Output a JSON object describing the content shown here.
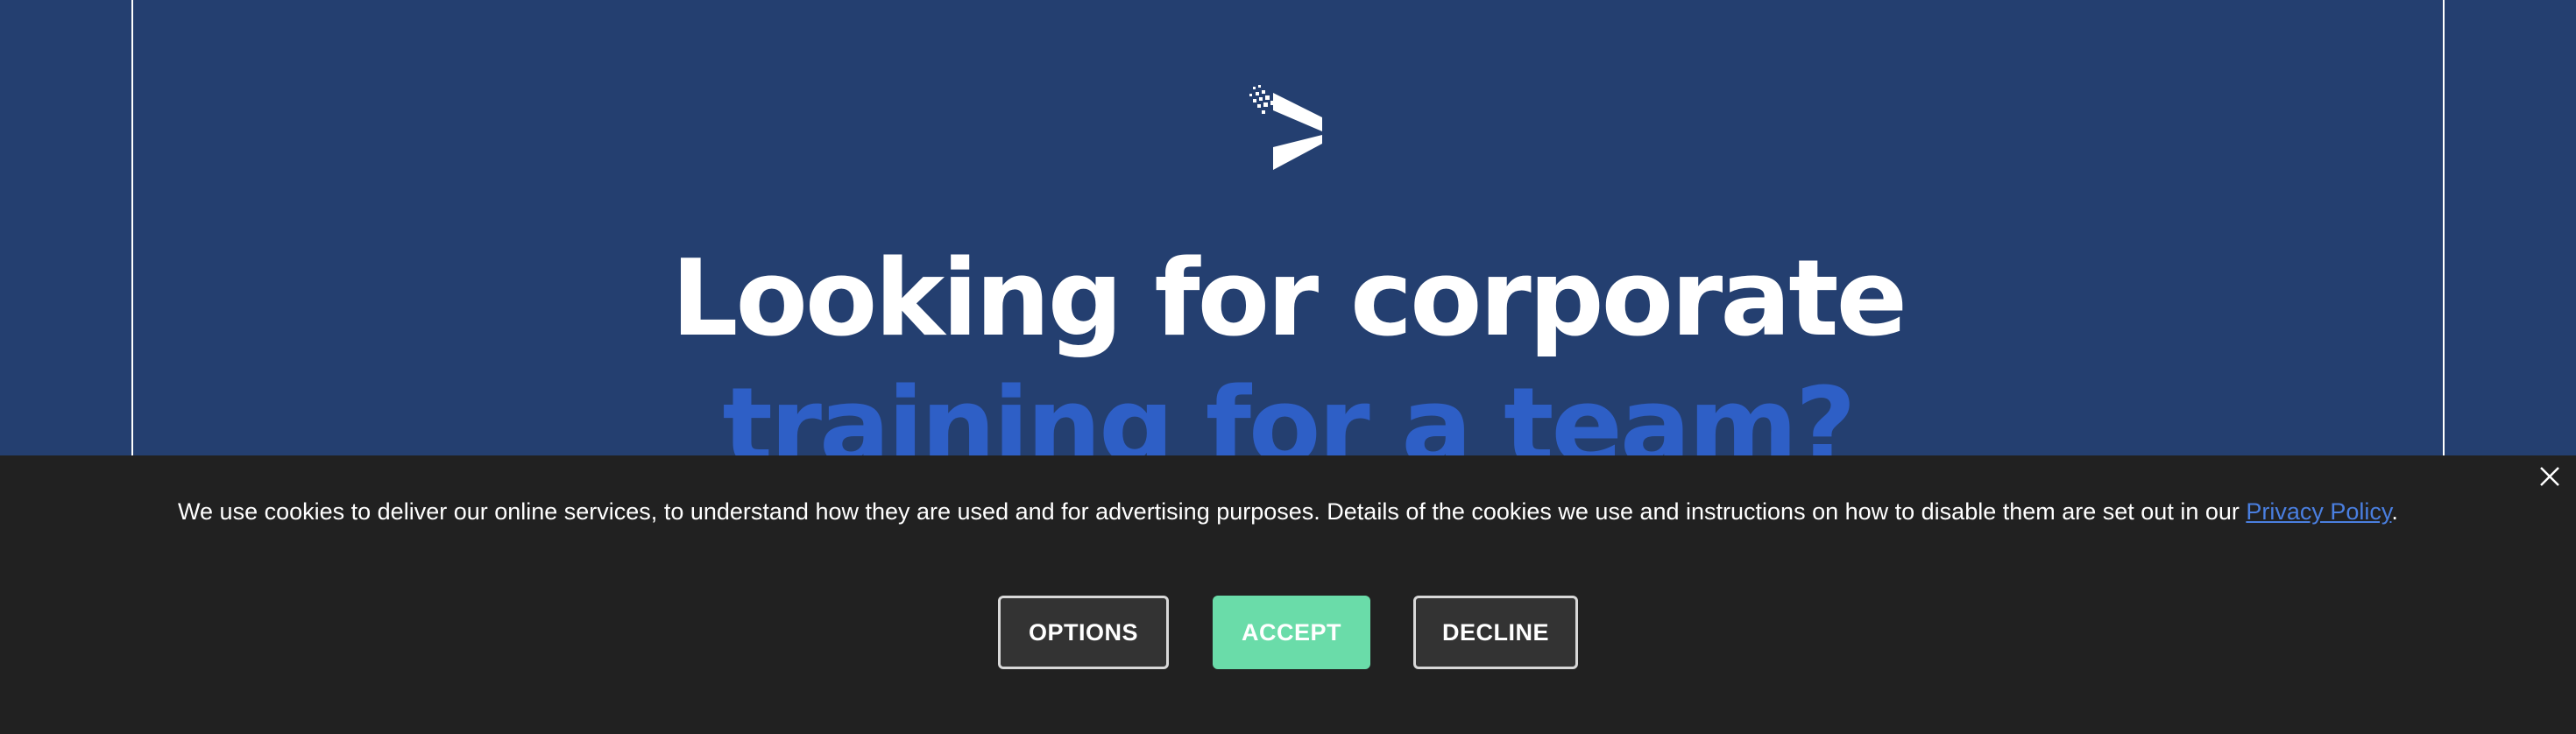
{
  "hero": {
    "headline_line1": "Looking for corporate",
    "headline_line2": "training for a team?"
  },
  "cookie_banner": {
    "message": "We use cookies to deliver our online services, to understand how they are used and for advertising purposes. Details of the cookies we use and instructions on how to disable them are set out in our ",
    "privacy_link": "Privacy Policy",
    "message_end": ".",
    "buttons": {
      "options": "OPTIONS",
      "accept": "ACCEPT",
      "decline": "DECLINE"
    }
  },
  "colors": {
    "hero_background": "#243f70",
    "headline_accent": "#2e5fc6",
    "banner_background": "#212121",
    "accept_button": "#6adca9",
    "link": "#4a7fe0"
  },
  "icons": [
    "brand-logo-icon",
    "close-icon"
  ]
}
